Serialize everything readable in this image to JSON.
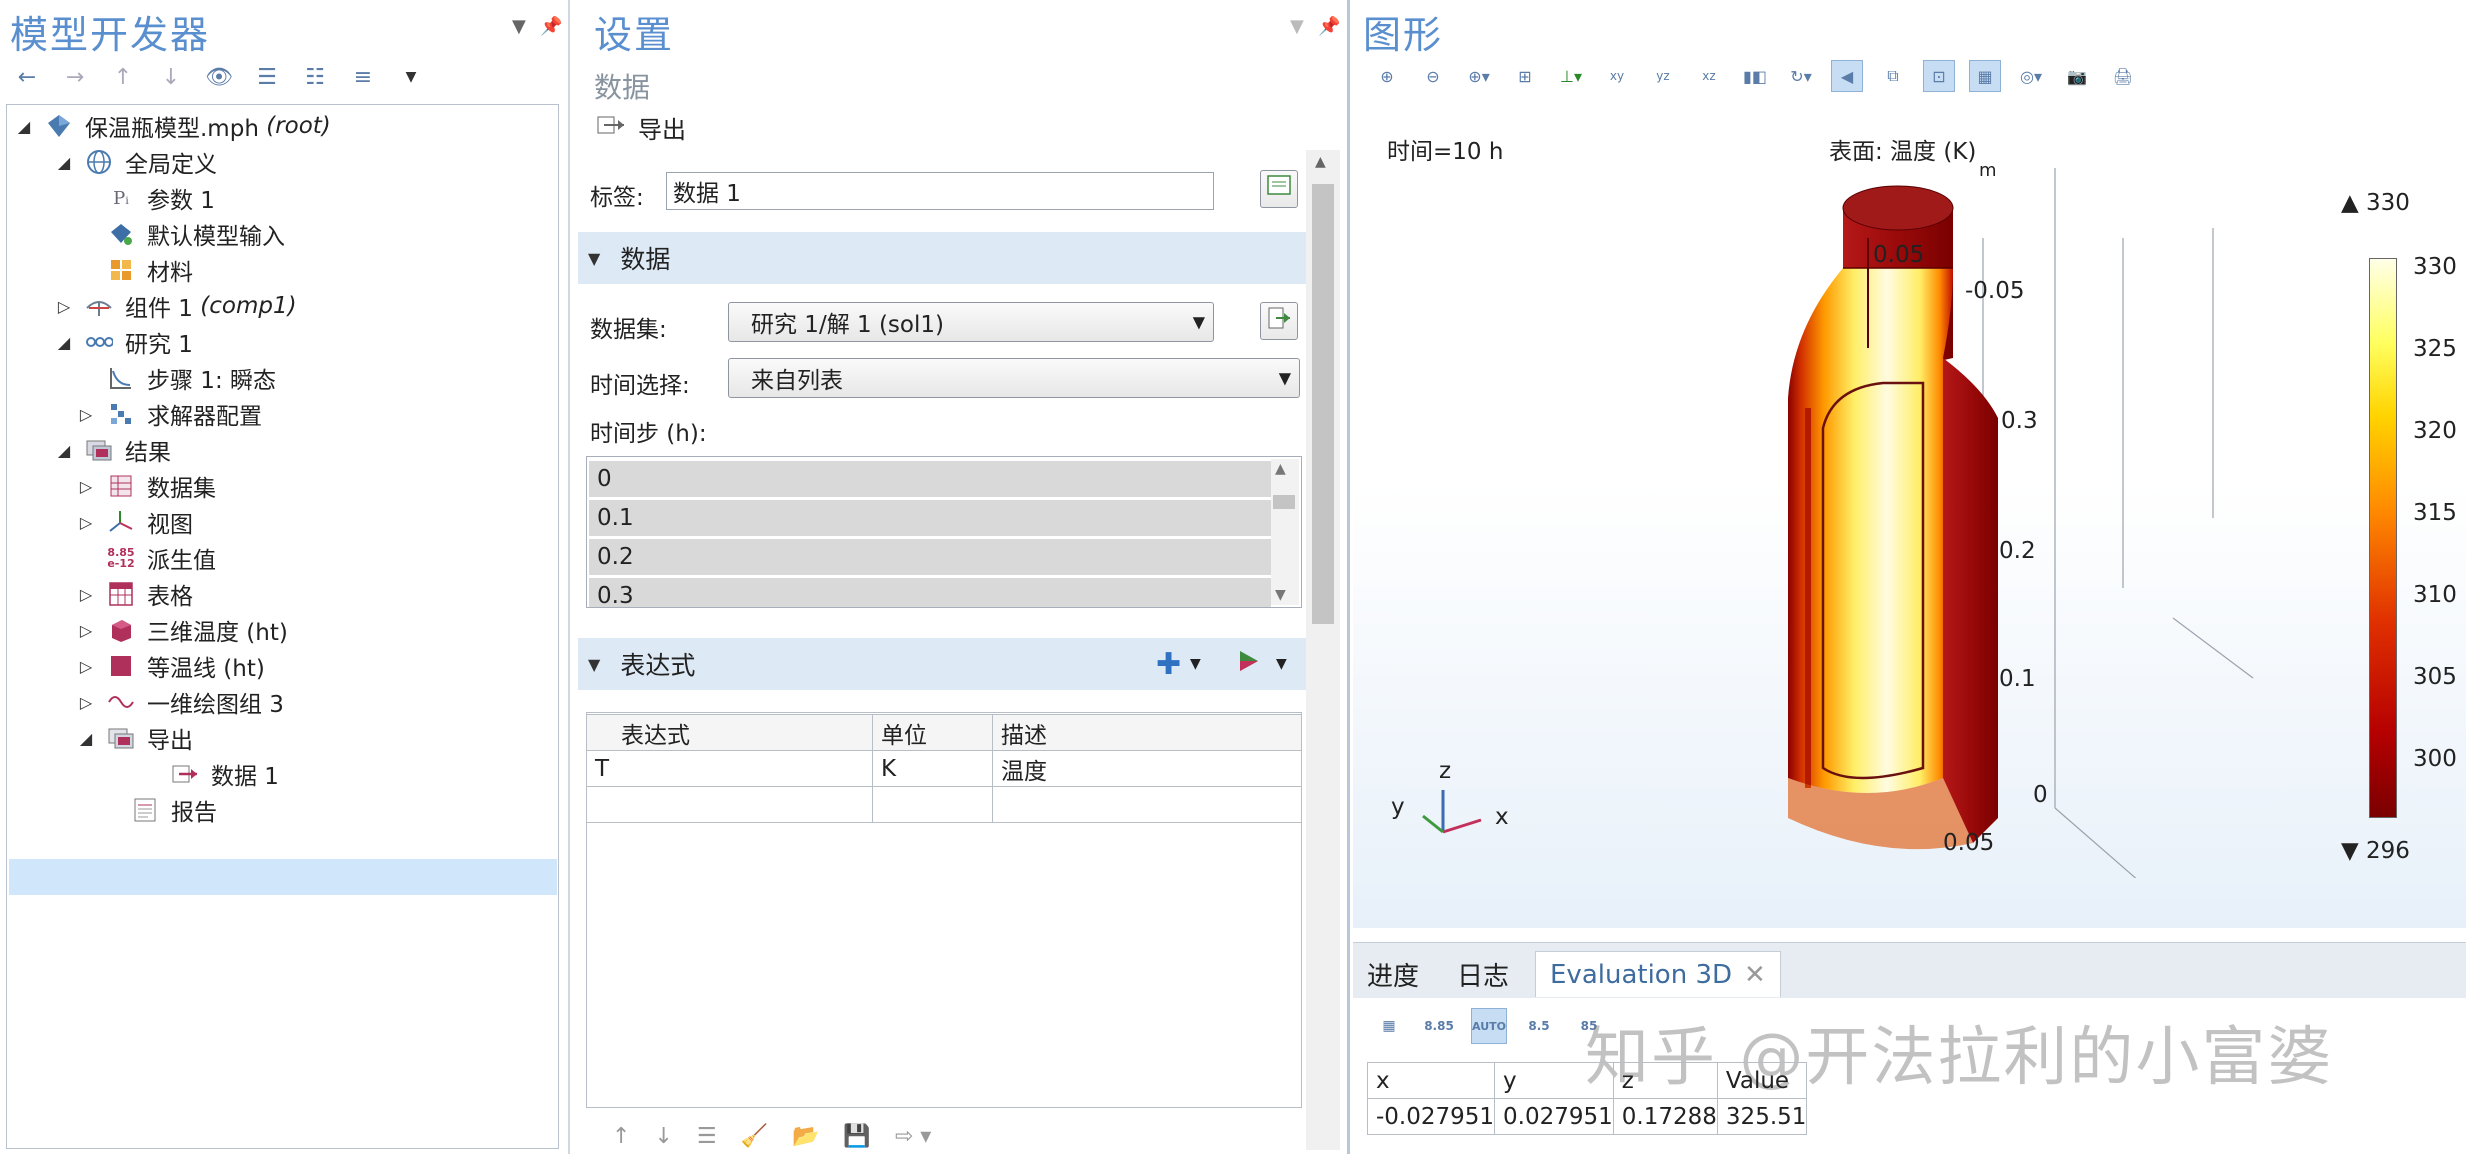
{
  "left_panel": {
    "title": "模型开发器",
    "tree": {
      "root": {
        "name": "保温瓶模型.mph",
        "tag": "(root)"
      },
      "global_definitions": "全局定义",
      "parameters": "参数 1",
      "default_model_inputs": "默认模型输入",
      "materials": "材料",
      "component": {
        "name": "组件 1",
        "tag": "(comp1)"
      },
      "study": "研究 1",
      "study_step": "步骤 1: 瞬态",
      "solver_config": "求解器配置",
      "results": "结果",
      "datasets": "数据集",
      "views": "视图",
      "derived_values": "派生值",
      "tables": "表格",
      "temp_3d": "三维温度 (ht)",
      "isotherms": "等温线 (ht)",
      "plot_group_1d": "一维绘图组 3",
      "export": "导出",
      "data1": "数据 1",
      "reports": "报告"
    }
  },
  "settings": {
    "title": "设置",
    "subtitle": "数据",
    "export_label": "导出",
    "tag_label": "标签:",
    "tag_value": "数据 1",
    "data_section": "数据",
    "dataset_label": "数据集:",
    "dataset_value": "研究 1/解 1 (sol1)",
    "time_select_label": "时间选择:",
    "time_select_value": "来自列表",
    "time_steps_label": "时间步 (h):",
    "time_steps": [
      "0",
      "0.1",
      "0.2",
      "0.3"
    ],
    "expr_section": "表达式",
    "expr_table": {
      "headers": [
        "表达式",
        "单位",
        "描述"
      ],
      "rows": [
        [
          "T",
          "K",
          "温度"
        ],
        [
          "",
          "",
          ""
        ]
      ]
    }
  },
  "graphics": {
    "title": "图形",
    "time_label": "时间=10 h",
    "surface_label": "表面: 温度 (K)",
    "unit_m": "m",
    "axis_ticks": [
      "0.05",
      "-0.05",
      "0.3",
      "0.2",
      "0.1",
      "0",
      "0.05"
    ],
    "axes": {
      "x": "x",
      "y": "y",
      "z": "z"
    },
    "colorbar": {
      "max_label": "▲ 330",
      "min_label": "▼ 296",
      "ticks": [
        "330",
        "325",
        "320",
        "315",
        "310",
        "305",
        "300"
      ]
    }
  },
  "bottom": {
    "tabs": [
      "进度",
      "日志",
      "Evaluation 3D"
    ],
    "watermark": "知乎 @开法拉利的小富婆",
    "eval_headers": [
      "x",
      "y",
      "z",
      "Value"
    ],
    "eval_row": [
      "-0.027951",
      "0.027951",
      "0.17288",
      "325.51"
    ],
    "toolbar_labels": {
      "e1": "8.85\ne-12",
      "auto": "AUTO",
      "e2": "8.5\ne-1"
    }
  },
  "colors": {
    "accent": "#5a8fcf",
    "section_bg": "#dde9f5",
    "selection": "#cfe6fb"
  }
}
